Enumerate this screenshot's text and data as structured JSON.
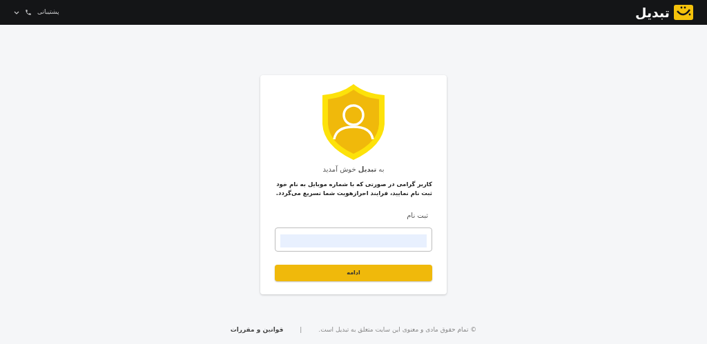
{
  "header": {
    "logo_text": "تبدیل",
    "support_label": "پشتیبانی"
  },
  "card": {
    "welcome": "به **تبدیل** خوش آمدید",
    "message": "کاربر گرامی در صورتی که با شماره موبایل به نام خود ثبت نام نمایید، فرایند احرازهویت شما تسریع می‌گردد.",
    "field_label": "ثبت نام",
    "button": "ادامه"
  },
  "footer": {
    "copyright": "© تمام حقوق مادی و معنوی این سایت متعلق به تبدیل است.",
    "separator": "|",
    "terms_link": "قوانین و مقررات"
  }
}
